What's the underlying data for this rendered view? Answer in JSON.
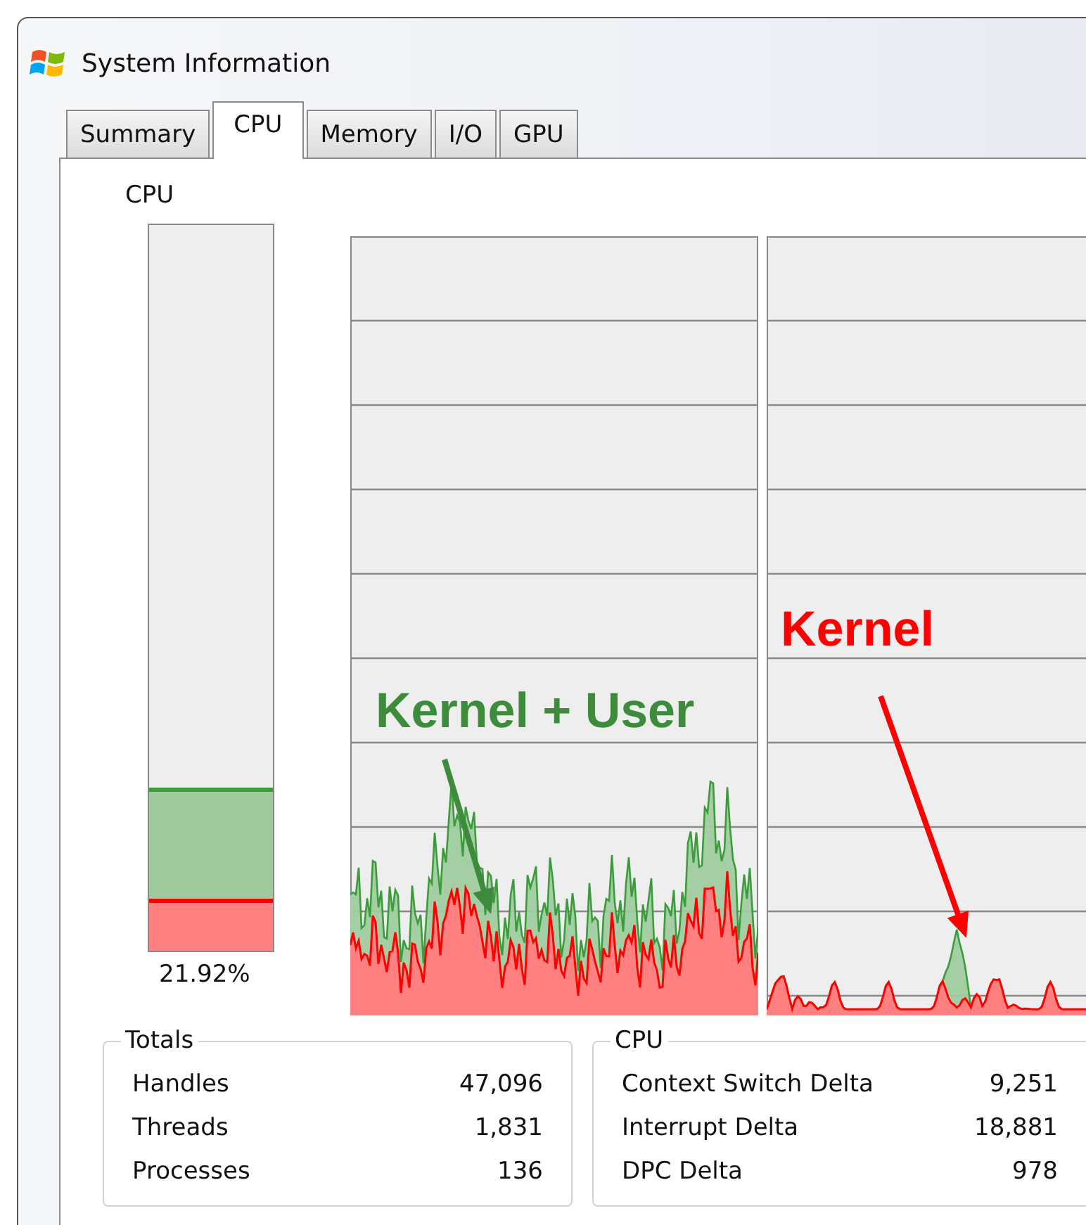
{
  "window": {
    "title": "System Information"
  },
  "tabs": [
    {
      "label": "Summary",
      "selected": false
    },
    {
      "label": "CPU",
      "selected": true
    },
    {
      "label": "Memory",
      "selected": false
    },
    {
      "label": "I/O",
      "selected": false
    },
    {
      "label": "GPU",
      "selected": false
    }
  ],
  "cpu_meter": {
    "label": "CPU",
    "level": 0.2192,
    "reading": "21.92%",
    "kernel": {
      "level": 0.066
    }
  },
  "annotations": [
    {
      "text": "Kernel + User",
      "color": "#3c8c3c"
    },
    {
      "text": "Kernel",
      "color": "#ff0000"
    }
  ],
  "totals": {
    "title": "Totals",
    "rows": [
      {
        "label": "Handles",
        "value": "47,096"
      },
      {
        "label": "Threads",
        "value": "1,831"
      },
      {
        "label": "Processes",
        "value": "136"
      }
    ]
  },
  "cpu": {
    "title": "CPU",
    "rows": [
      {
        "label": "Context Switch Delta",
        "value": "9,251"
      },
      {
        "label": "Interrupt Delta",
        "value": "18,881"
      },
      {
        "label": "DPC Delta",
        "value": "978"
      }
    ]
  }
}
